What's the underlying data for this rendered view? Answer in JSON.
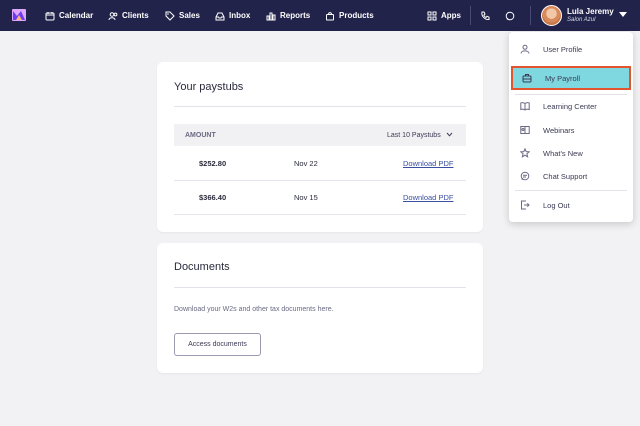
{
  "nav": {
    "items": [
      {
        "label": "Calendar",
        "icon": "calendar-icon"
      },
      {
        "label": "Clients",
        "icon": "users-icon"
      },
      {
        "label": "Sales",
        "icon": "tag-icon"
      },
      {
        "label": "Inbox",
        "icon": "inbox-icon"
      },
      {
        "label": "Reports",
        "icon": "bar-chart-icon"
      },
      {
        "label": "Products",
        "icon": "bag-icon"
      }
    ],
    "apps_label": "Apps",
    "user_name": "Lula Jeremy",
    "user_subtitle": "Salon Azul",
    "bar_color": "#22234a"
  },
  "paystubs": {
    "title": "Your paystubs",
    "col_amount": "AMOUNT",
    "filter_label": "Last 10 Paystubs",
    "rows": [
      {
        "amount": "$252.80",
        "date": "Nov 22",
        "action": "Download PDF"
      },
      {
        "amount": "$366.40",
        "date": "Nov 15",
        "action": "Download PDF"
      }
    ]
  },
  "documents": {
    "title": "Documents",
    "description": "Download your W2s and other tax documents here.",
    "button_label": "Access documents"
  },
  "user_menu": {
    "items": [
      {
        "label": "User Profile",
        "icon": "user-icon"
      },
      {
        "label": "My Payroll",
        "icon": "payroll-icon",
        "active": true
      },
      {
        "label": "Learning Center",
        "icon": "book-icon"
      },
      {
        "label": "Webinars",
        "icon": "webinar-icon"
      },
      {
        "label": "What's New",
        "icon": "star-icon"
      },
      {
        "label": "Chat Support",
        "icon": "chat-icon"
      },
      {
        "label": "Log Out",
        "icon": "logout-icon"
      }
    ],
    "highlight_color": "#7fd7e0",
    "highlight_border": "#e2542d"
  }
}
